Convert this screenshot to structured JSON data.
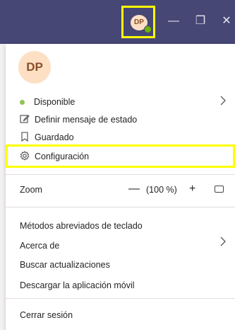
{
  "titlebar": {
    "avatar_initials": "DP",
    "minimize_icon": "—",
    "maximize_icon": "❐",
    "close_icon": "✕"
  },
  "profile": {
    "initials": "DP"
  },
  "menu": {
    "status": "Disponible",
    "set_status_message": "Definir mensaje de estado",
    "saved": "Guardado",
    "settings": "Configuración",
    "zoom_label": "Zoom",
    "zoom_minus": "—",
    "zoom_value": "(100 %)",
    "zoom_plus": "+",
    "keyboard_shortcuts": "Métodos abreviados de teclado",
    "about": "Acerca de",
    "check_updates": "Buscar actualizaciones",
    "download_mobile": "Descargar la aplicación móvil",
    "sign_out": "Cerrar sesión"
  },
  "icons": {
    "status": "status-available-icon",
    "edit": "edit-status-icon",
    "bookmark": "bookmark-icon",
    "settings": "gear-icon",
    "fit": "fit-to-screen-icon",
    "chevron": "chevron-right-icon"
  },
  "colors": {
    "titlebar": "#464775",
    "highlight": "#ffff00",
    "available": "#92c353",
    "avatar_bg": "#fde0c4"
  }
}
